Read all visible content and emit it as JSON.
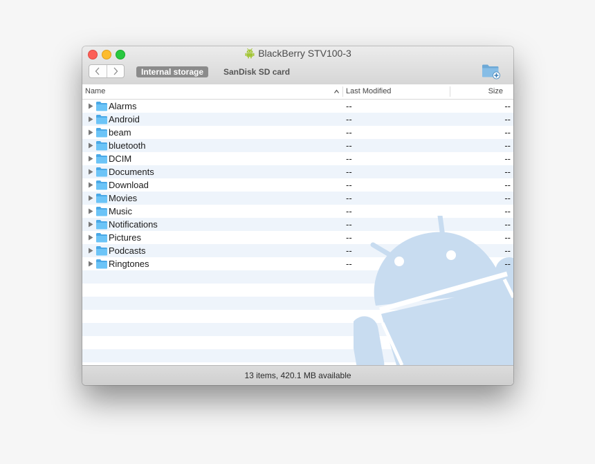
{
  "window": {
    "title": "BlackBerry STV100-3",
    "title_icon": "android-robot-icon"
  },
  "toolbar": {
    "back_icon": "chevron-left-icon",
    "forward_icon": "chevron-right-icon",
    "tabs": [
      {
        "label": "Internal storage",
        "active": true
      },
      {
        "label": "SanDisk SD card",
        "active": false
      }
    ],
    "new_folder_icon": "new-folder-icon"
  },
  "columns": {
    "name": "Name",
    "last_modified": "Last Modified",
    "size": "Size",
    "sort": "ascending"
  },
  "files": [
    {
      "name": "Alarms",
      "modified": "--",
      "size": "--"
    },
    {
      "name": "Android",
      "modified": "--",
      "size": "--"
    },
    {
      "name": "beam",
      "modified": "--",
      "size": "--"
    },
    {
      "name": "bluetooth",
      "modified": "--",
      "size": "--"
    },
    {
      "name": "DCIM",
      "modified": "--",
      "size": "--"
    },
    {
      "name": "Documents",
      "modified": "--",
      "size": "--"
    },
    {
      "name": "Download",
      "modified": "--",
      "size": "--"
    },
    {
      "name": "Movies",
      "modified": "--",
      "size": "--"
    },
    {
      "name": "Music",
      "modified": "--",
      "size": "--"
    },
    {
      "name": "Notifications",
      "modified": "--",
      "size": "--"
    },
    {
      "name": "Pictures",
      "modified": "--",
      "size": "--"
    },
    {
      "name": "Podcasts",
      "modified": "--",
      "size": "--"
    },
    {
      "name": "Ringtones",
      "modified": "--",
      "size": "--"
    }
  ],
  "status": {
    "text": "13 items, 420.1 MB available"
  },
  "colors": {
    "folder": "#5bbdf5",
    "tab_active_bg": "#8b8b8b",
    "stripe": "#eef4fb",
    "watermark": "#c8dcf0"
  }
}
